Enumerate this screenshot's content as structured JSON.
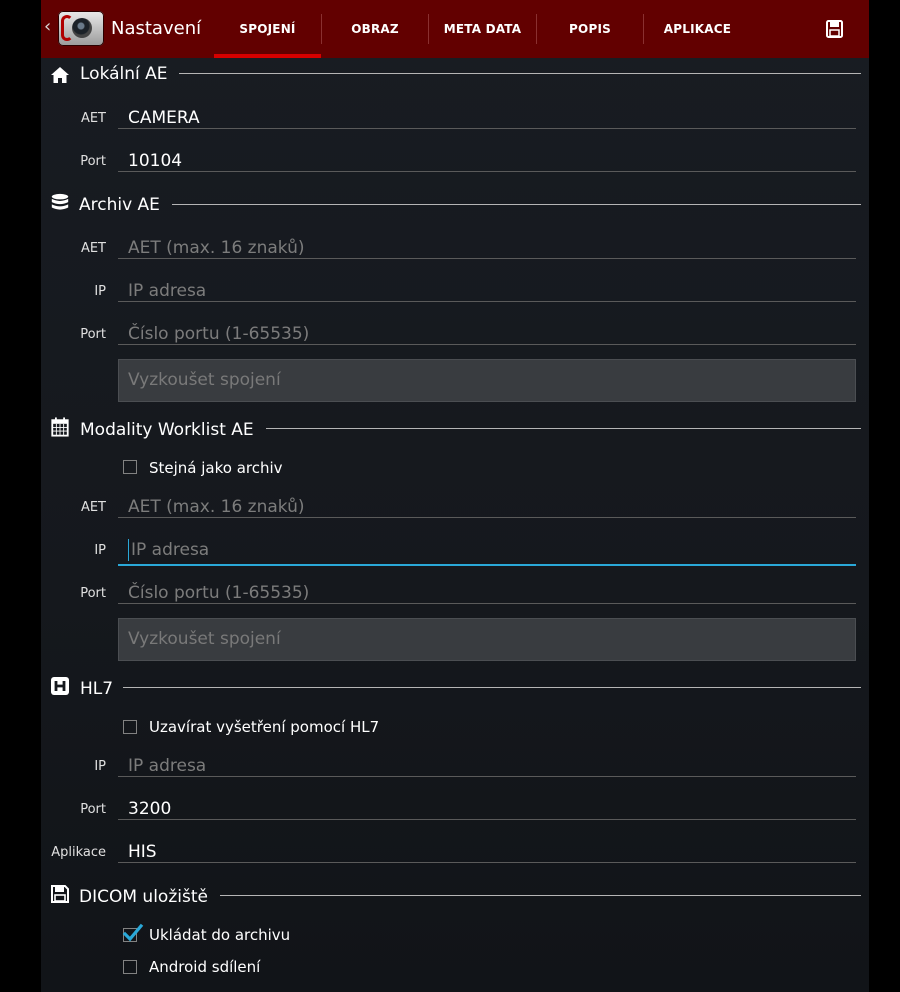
{
  "action_bar": {
    "title": "Nastavení",
    "tabs": [
      "SPOJENÍ",
      "OBRAZ",
      "META DATA",
      "POPIS",
      "APLIKACE"
    ],
    "active_tab": "SPOJENÍ"
  },
  "colors": {
    "action_bar": "#620000",
    "tab_indicator": "#d60000",
    "focus_accent": "#2aa8d8",
    "checkmark": "#2aa8d8"
  },
  "local_ae": {
    "title": "Lokální AE",
    "icon": "home-icon",
    "aet": {
      "label": "AET",
      "value": "CAMERA"
    },
    "port": {
      "label": "Port",
      "value": "10104"
    }
  },
  "archive_ae": {
    "title": "Archiv AE",
    "icon": "database-icon",
    "aet": {
      "label": "AET",
      "placeholder": "AET (max. 16 znaků)"
    },
    "ip": {
      "label": "IP",
      "placeholder": "IP adresa"
    },
    "port": {
      "label": "Port",
      "placeholder": "Číslo portu (1-65535)"
    },
    "test_button": "Vyzkoušet spojení"
  },
  "worklist_ae": {
    "title": "Modality Worklist AE",
    "icon": "calendar-icon",
    "same_as_archive": {
      "label": "Stejná jako archiv",
      "checked": false
    },
    "aet": {
      "label": "AET",
      "placeholder": "AET (max. 16 znaků)"
    },
    "ip": {
      "label": "IP",
      "placeholder": "IP adresa"
    },
    "port": {
      "label": "Port",
      "placeholder": "Číslo portu (1-65535)"
    },
    "test_button": "Vyzkoušet spojení"
  },
  "hl7": {
    "title": "HL7",
    "icon": "hospital-icon",
    "close_with_hl7": {
      "label": "Uzavírat vyšetření pomocí HL7",
      "checked": false
    },
    "ip": {
      "label": "IP",
      "placeholder": "IP adresa"
    },
    "port": {
      "label": "Port",
      "value": "3200"
    },
    "application": {
      "label": "Aplikace",
      "value": "HIS"
    }
  },
  "dicom_storage": {
    "title": "DICOM uložiště",
    "icon": "floppy-icon",
    "save_to_archive": {
      "label": "Ukládat do archivu",
      "checked": true
    },
    "android_sharing": {
      "label": "Android sdílení",
      "checked": false
    }
  }
}
